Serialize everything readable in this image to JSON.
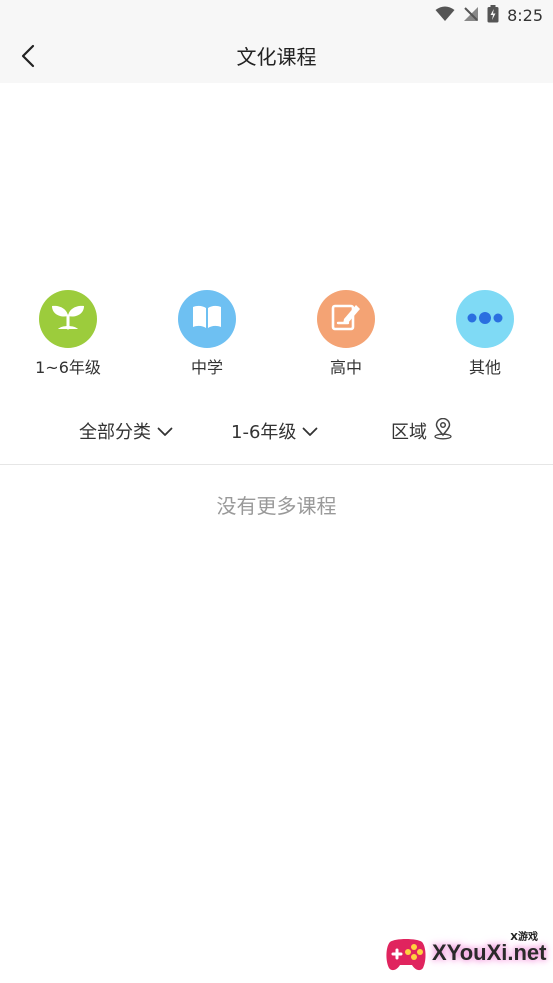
{
  "status_bar": {
    "time": "8:25",
    "icons": [
      "wifi-icon",
      "no-signal-icon",
      "battery-charging-icon"
    ]
  },
  "nav": {
    "title": "文化课程",
    "back_icon": "chevron-left-icon"
  },
  "categories": [
    {
      "label": "1~6年级",
      "icon": "sprout-icon",
      "color": "#9ccc3c"
    },
    {
      "label": "中学",
      "icon": "open-book-icon",
      "color": "#6ec0f2"
    },
    {
      "label": "高中",
      "icon": "notepad-pencil-icon",
      "color": "#f4a374"
    },
    {
      "label": "其他",
      "icon": "more-dots-icon",
      "color": "#7fdaf5"
    }
  ],
  "filters": {
    "category": {
      "label": "全部分类",
      "icon": "chevron-down-icon"
    },
    "grade": {
      "label": "1-6年级",
      "icon": "chevron-down-icon"
    },
    "region": {
      "label": "区域",
      "icon": "location-pin-icon"
    }
  },
  "list": {
    "empty_message": "没有更多课程"
  },
  "watermark": {
    "main": "XYouXi.net",
    "sub": "X游戏"
  },
  "colors": {
    "nav_background": "#f7f7f7",
    "divider": "#e6e6e6",
    "empty_text": "#999999"
  }
}
